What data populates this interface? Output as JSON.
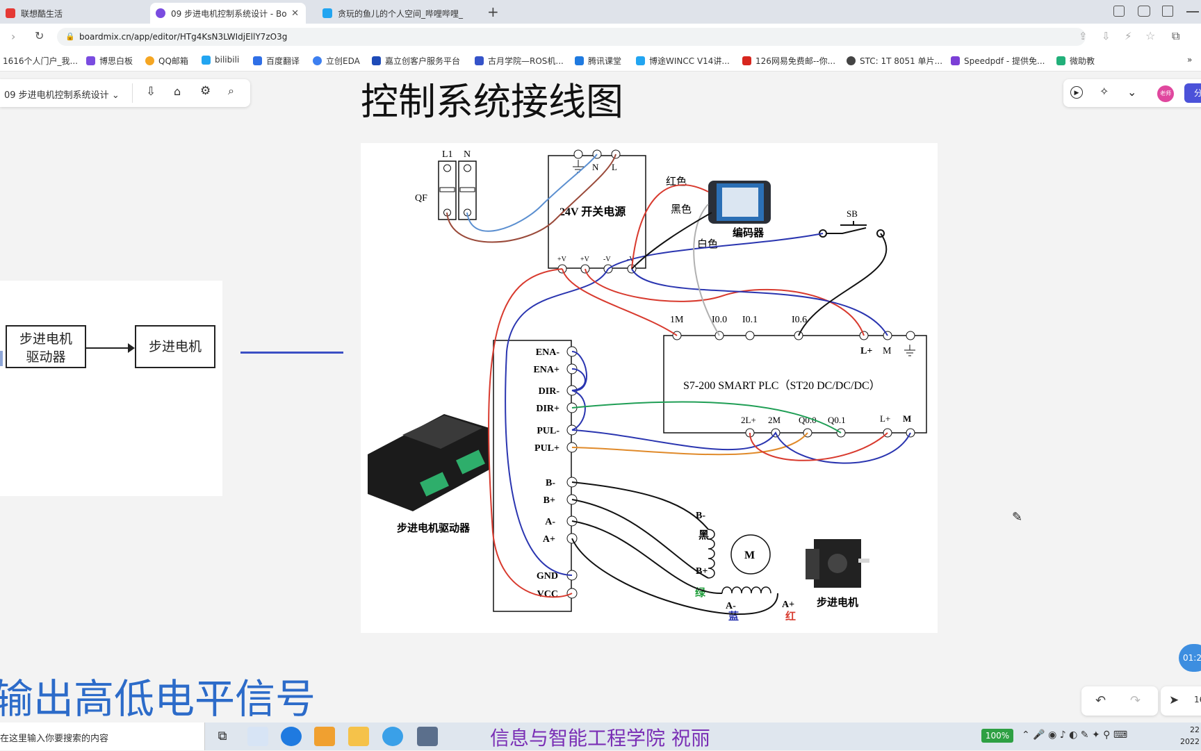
{
  "browser": {
    "tabs": [
      {
        "title": "联想酷生活"
      },
      {
        "title": "09 步进电机控制系统设计 - Bo"
      },
      {
        "title": "贪玩的鱼儿的个人空间_哔哩哔哩_"
      }
    ],
    "url": "boardmix.cn/app/editor/HTg4KsN3LWIdjEllY7zO3g",
    "bookmarks": [
      "1616个人门户_我...",
      "博思白板",
      "QQ邮箱",
      "bilibili",
      "百度翻译",
      "立创EDA",
      "嘉立创客户服务平台",
      "古月学院—ROS机...",
      "腾讯课堂",
      "博途WINCC V14讲...",
      "126网易免费邮--你...",
      "STC: 1T 8051 单片...",
      "Speedpdf - 提供免...",
      "微助教"
    ]
  },
  "editor": {
    "doc_title": "09 步进电机控制系统设计",
    "avatar_label": "老师",
    "share_label": "分",
    "zoom": "16",
    "timer": "01:2"
  },
  "slide": {
    "title": "控制系统接线图",
    "left_block_1_line1": "步进电机",
    "left_block_1_line2": "驱动器",
    "left_block_2": "步进电机",
    "bottom_text": "输出高低电平信号",
    "footer": "信息与智能工程学院  祝丽"
  },
  "diagram": {
    "qf_top_labels": [
      "L1",
      "N"
    ],
    "qf_label": "QF",
    "psu_top_labels": [
      "N",
      "L"
    ],
    "psu_label": "24V 开关电源",
    "psu_bottom_labels": [
      "+V",
      "+V",
      "-V",
      "-V"
    ],
    "encoder_wires": [
      "红色",
      "黑色",
      "白色"
    ],
    "encoder_label": "编码器",
    "sb_label": "SB",
    "plc_top_labels": [
      "1M",
      "I0.0",
      "I0.1",
      "I0.6",
      "L+",
      "M"
    ],
    "plc_label": "S7-200 SMART  PLC（ST20  DC/DC/DC）",
    "plc_bottom_labels": [
      "2L+",
      "2M",
      "Q0.0",
      "Q0.1",
      "L+",
      "M"
    ],
    "driver_terms": [
      "ENA-",
      "ENA+",
      "DIR-",
      "DIR+",
      "PUL-",
      "PUL+",
      "B-",
      "B+",
      "A-",
      "A+",
      "GND",
      "VCC"
    ],
    "driver_label": "步进电机驱动器",
    "motor_symbol": "M",
    "coil_labels": [
      "B-",
      "黑",
      "B+",
      "绿",
      "A-",
      "蓝",
      "A+",
      "红"
    ],
    "motor_label": "步进电机"
  },
  "taskbar": {
    "search_placeholder": "在这里输入你要搜索的内容",
    "battery": "100%",
    "clock_top": "22",
    "clock_bottom": "2022"
  },
  "colors": {
    "wire_red": "#d83a2e",
    "wire_blue": "#2a35b0",
    "wire_black": "#111111",
    "wire_green": "#1f9e55",
    "wire_orange": "#e08a2a",
    "wire_brown": "#9a4a3a",
    "wire_lightblue": "#5b8fd0",
    "accent": "#2c6bc9"
  }
}
